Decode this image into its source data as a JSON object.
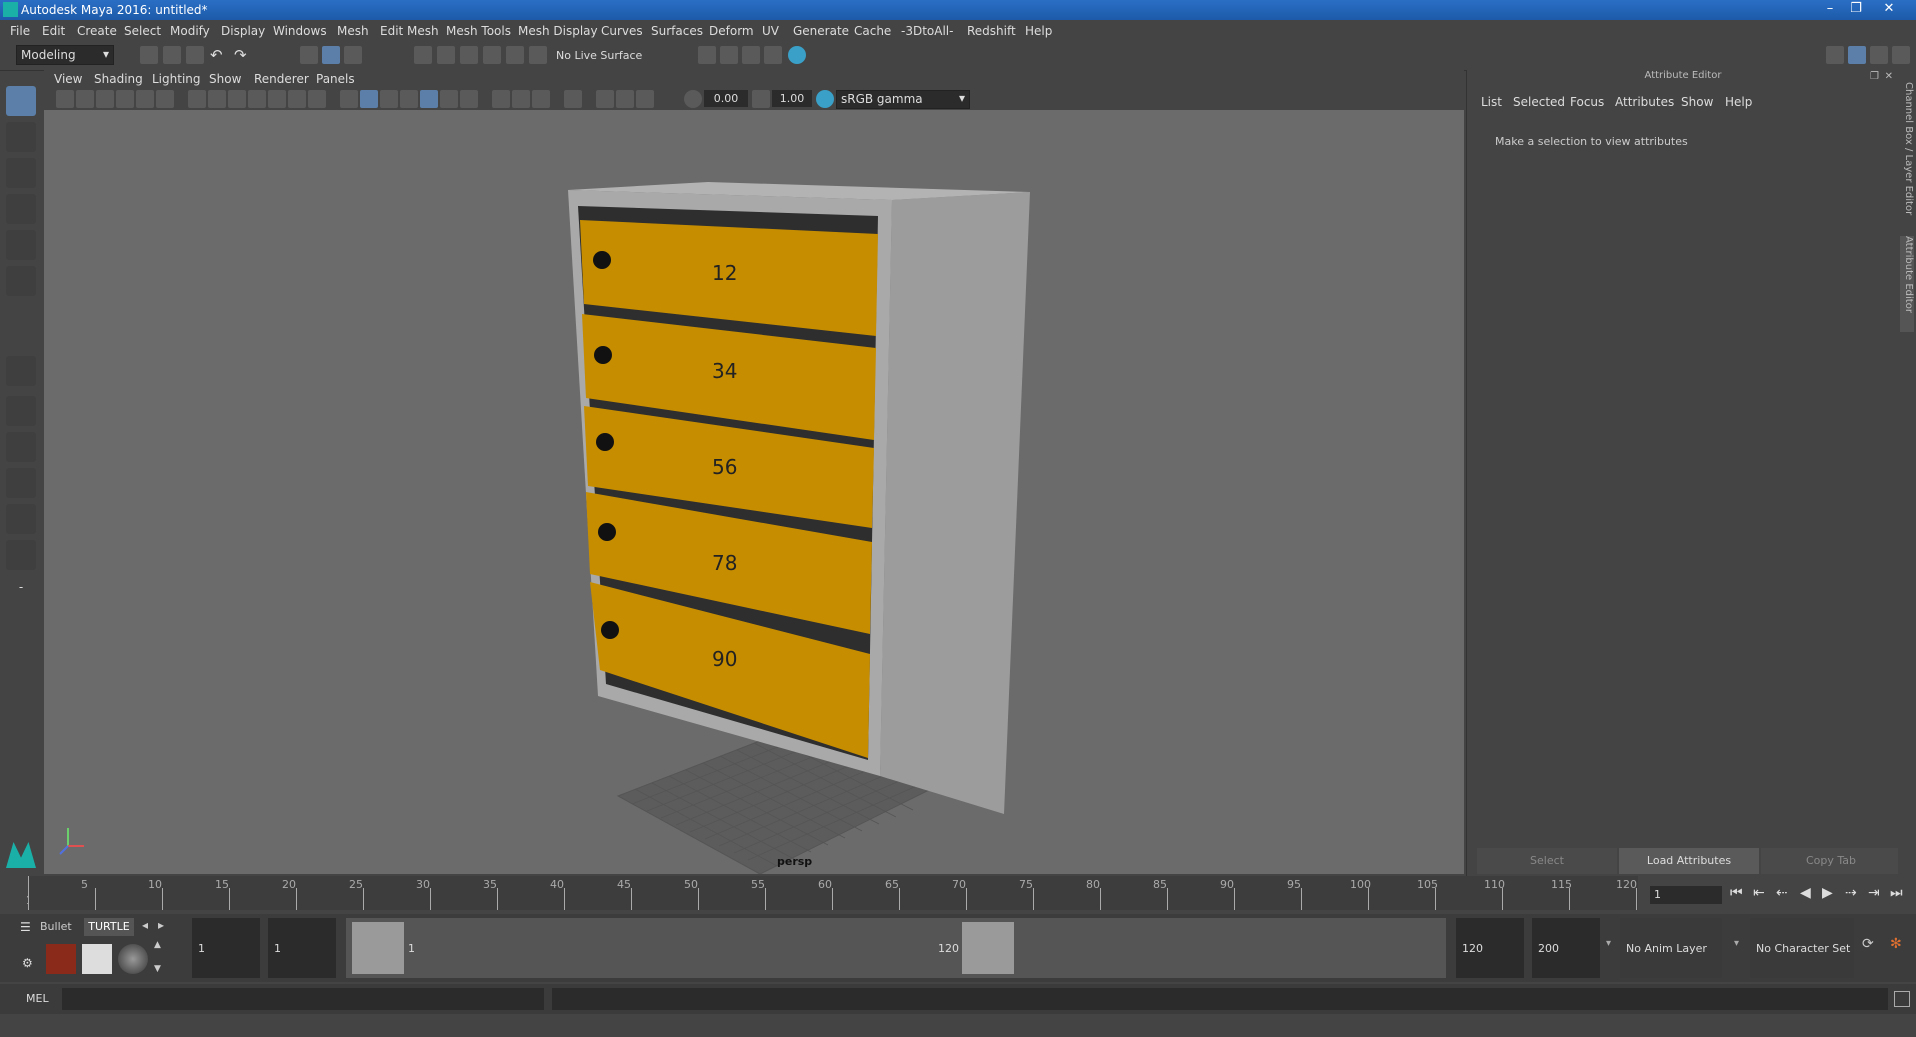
{
  "window": {
    "title": "Autodesk Maya 2016: untitled*",
    "controls": [
      "–",
      "❐",
      "✕"
    ]
  },
  "menubar": [
    "File",
    "Edit",
    "Create",
    "Select",
    "Modify",
    "Display",
    "Windows",
    "Mesh",
    "Edit Mesh",
    "Mesh Tools",
    "Mesh Display",
    "Curves",
    "Surfaces",
    "Deform",
    "UV",
    "Generate",
    "Cache",
    "-3DtoAll-",
    "Redshift",
    "Help"
  ],
  "shelf": {
    "workspace": "Modeling",
    "live_surface": "No Live Surface"
  },
  "viewport": {
    "menu": [
      "View",
      "Shading",
      "Lighting",
      "Show",
      "Renderer",
      "Panels"
    ],
    "exposure": "0.00",
    "gamma": "1.00",
    "color_space": "sRGB gamma",
    "camera_label": "persp",
    "mailbox_numbers": [
      "12",
      "34",
      "56",
      "78",
      "90"
    ]
  },
  "attribute_editor": {
    "header": "Attribute Editor",
    "tabs": [
      "List",
      "Selected",
      "Focus",
      "Attributes",
      "Show",
      "Help"
    ],
    "message": "Make a selection to view attributes",
    "buttons": {
      "select": "Select",
      "load": "Load Attributes",
      "copy": "Copy Tab"
    }
  },
  "side_tabs": {
    "channel_box": "Channel Box / Layer Editor",
    "attribute_editor": "Attribute Editor"
  },
  "timeline": {
    "ticks": [
      "5",
      "10",
      "15",
      "20",
      "25",
      "30",
      "35",
      "40",
      "45",
      "50",
      "55",
      "60",
      "65",
      "70",
      "75",
      "80",
      "85",
      "90",
      "95",
      "100",
      "105",
      "110",
      "115",
      "120"
    ],
    "start_marker": "1",
    "current_frame": "1"
  },
  "range": {
    "shelf_tabs": [
      "Bullet",
      "TURTLE"
    ],
    "start_field": "1",
    "playback_start": "1",
    "range_start_label": "1",
    "range_end_label": "120",
    "playback_end": "120",
    "end_field": "200",
    "anim_layer": "No Anim Layer",
    "character_set": "No Character Set"
  },
  "command_line": {
    "language": "MEL"
  }
}
